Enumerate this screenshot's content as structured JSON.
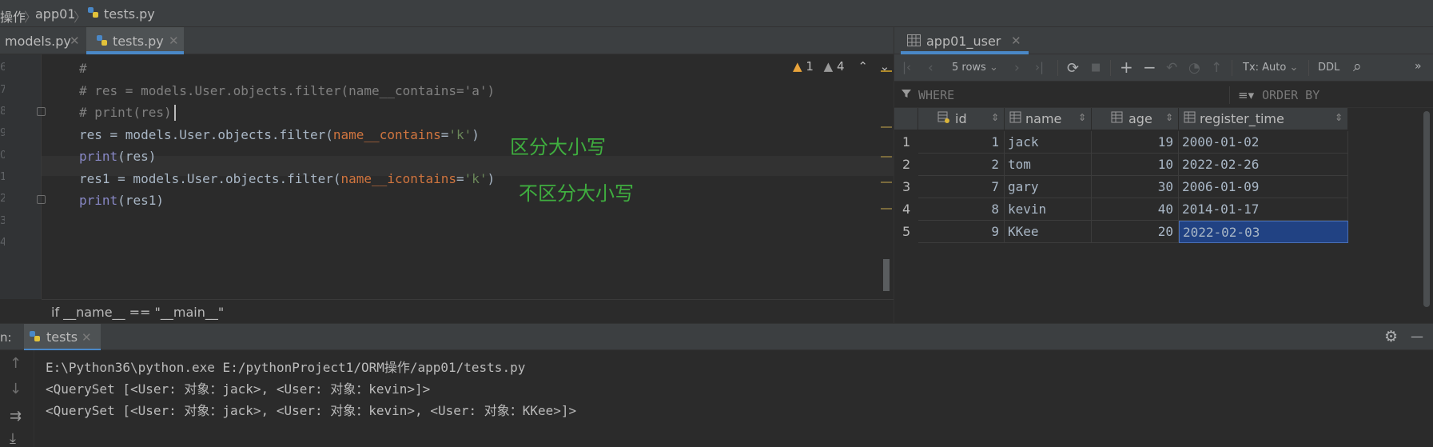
{
  "breadcrumb": {
    "items": [
      "操作",
      "app01",
      "tests.py"
    ],
    "separator": "〉"
  },
  "editor_tabs": [
    {
      "label": "models.py",
      "close": "✕",
      "active": false
    },
    {
      "label": "tests.py",
      "close": "✕",
      "active": true
    }
  ],
  "editor": {
    "line_numbers": [
      "6",
      "7",
      "8",
      "9",
      "0",
      "1",
      "2",
      "3",
      "4"
    ],
    "lines": {
      "l1": "#",
      "l2": "# res = models.User.objects.filter(name__contains='a')",
      "l3": "# print(res)",
      "l4_a": "res = models.User.objects.filter(",
      "l4_b": "name__contains",
      "l4_c": "=",
      "l4_d": "'k'",
      "l4_e": ")",
      "l5_a": "print",
      "l5_b": "(res)",
      "l6_a": "res1 = models.User.objects.filter(",
      "l6_b": "name__icontains",
      "l6_c": "=",
      "l6_d": "'k'",
      "l6_e": ")",
      "l7_a": "print",
      "l7_b": "(res1)"
    },
    "annotations": {
      "case_sensitive": "区分大小写",
      "case_insensitive": "不区分大小写"
    },
    "inspections": {
      "warning_count": "1",
      "weak_warning_count": "4",
      "up": "⌃",
      "down": "⌄"
    },
    "bottom_breadcrumb": "if __name__ == \"__main__\""
  },
  "db_panel": {
    "tab_label": "app01_user",
    "tab_close": "✕",
    "toolbar": {
      "first": "|‹",
      "prev": "‹",
      "rows": "5 rows",
      "next": "›",
      "last": "›|",
      "refresh": "⟳",
      "stop": "■",
      "add": "+",
      "remove": "−",
      "revert": "↶",
      "preview": "◔",
      "submit": "↑",
      "tx": "Tx: Auto",
      "ddl": "DDL",
      "search": "⌕",
      "more": "»"
    },
    "filter": {
      "where": "WHERE",
      "order_by": "ORDER BY"
    },
    "columns": [
      "id",
      "name",
      "age",
      "register_time"
    ],
    "sort_glyph": "⇕",
    "rows": [
      {
        "rn": "1",
        "id": "1",
        "name": "jack",
        "age": "19",
        "register_time": "2000-01-02"
      },
      {
        "rn": "2",
        "id": "2",
        "name": "tom",
        "age": "10",
        "register_time": "2022-02-26"
      },
      {
        "rn": "3",
        "id": "7",
        "name": "gary",
        "age": "30",
        "register_time": "2006-01-09"
      },
      {
        "rn": "4",
        "id": "8",
        "name": "kevin",
        "age": "40",
        "register_time": "2014-01-17"
      },
      {
        "rn": "5",
        "id": "9",
        "name": "KKee",
        "age": "20",
        "register_time": "2022-02-03"
      }
    ],
    "selected_cell": "register_time of row 5"
  },
  "run_panel": {
    "label": "n:",
    "tab_label": "tests",
    "tab_close": "✕",
    "settings": "⚙",
    "minimize": "—",
    "output": [
      "E:\\Python36\\python.exe E:/pythonProject1/ORM操作/app01/tests.py",
      "<QuerySet [<User: 对象：jack>, <User: 对象：kevin>]>",
      "<QuerySet [<User: 对象：jack>, <User: 对象：kevin>, <User: 对象：KKee>]>"
    ]
  },
  "colors": {
    "background": "#2b2b2b",
    "panel": "#3c3f41",
    "accent": "#4a88c7",
    "comment": "#808080",
    "keyword_arg": "#cc7832",
    "string": "#6a8759",
    "builtin": "#8888c6",
    "annotation": "#3fae3f",
    "selection": "#214283"
  },
  "icons": {
    "python_file": "python-file-icon",
    "table": "table-icon",
    "column": "column-icon",
    "key_column": "key-column-icon",
    "filter": "filter-icon",
    "sort": "sort-icon",
    "settings": "gear-icon"
  }
}
